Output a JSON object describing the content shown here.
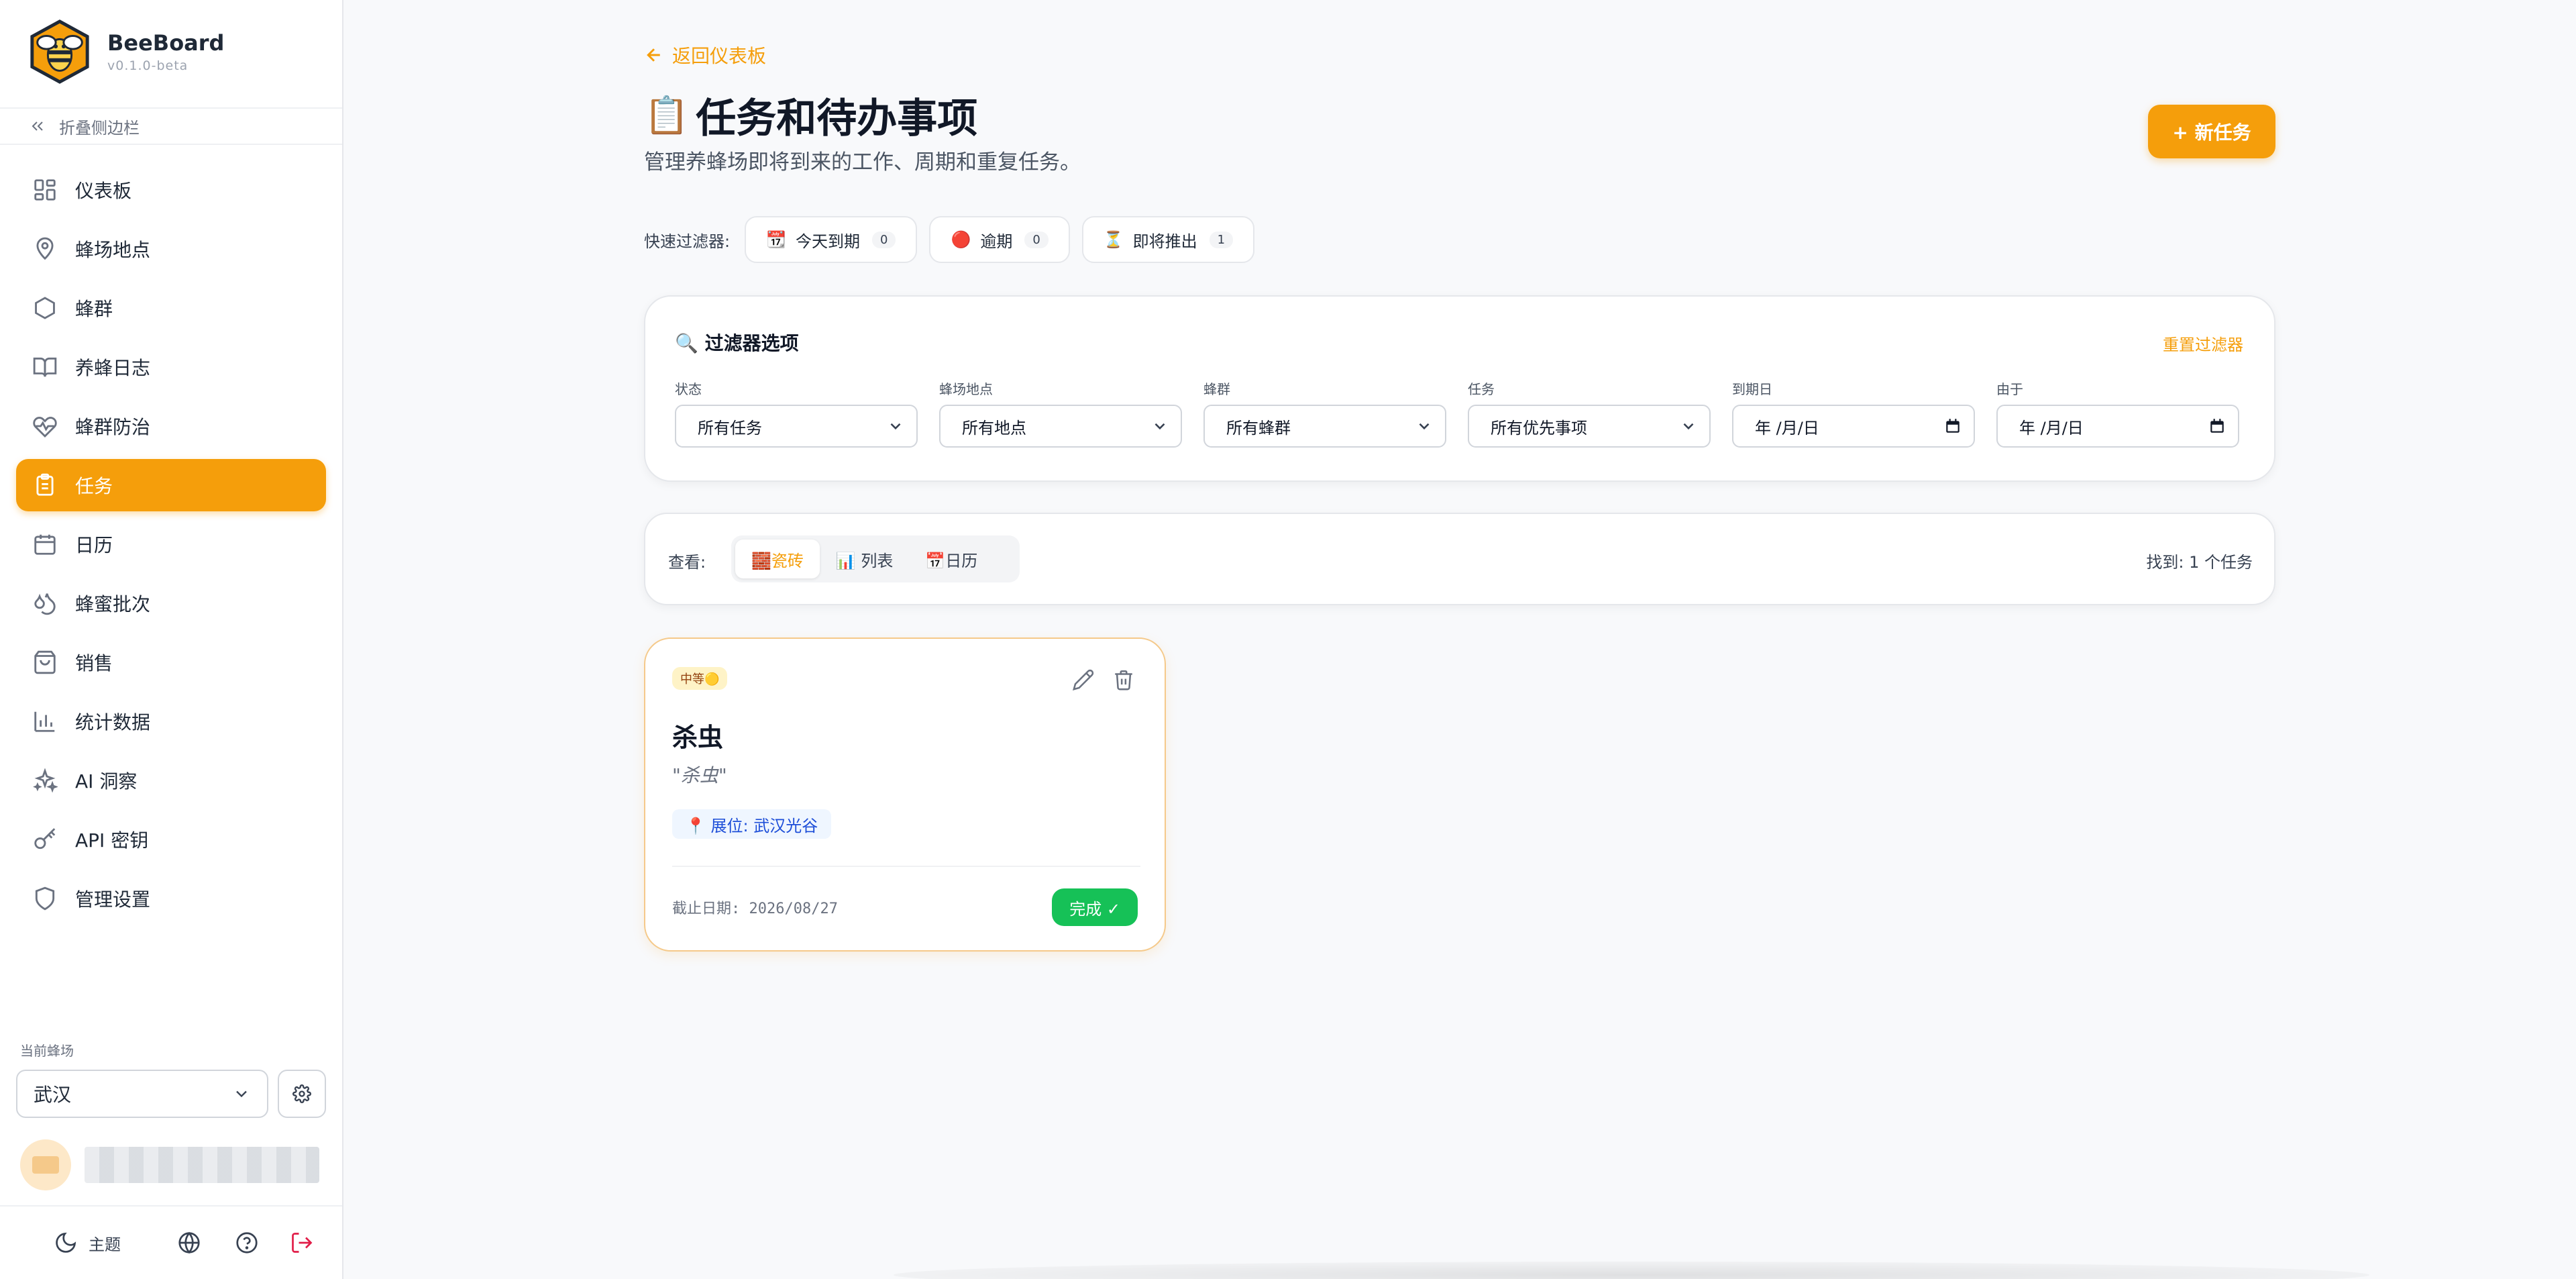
{
  "brand": {
    "name": "BeeBoard",
    "version": "v0.1.0-beta"
  },
  "sidebar": {
    "collapse_label": "折叠侧边栏",
    "items": [
      {
        "label": "仪表板",
        "icon": "dashboard-icon"
      },
      {
        "label": "蜂场地点",
        "icon": "map-pin-icon"
      },
      {
        "label": "蜂群",
        "icon": "hexagon-icon"
      },
      {
        "label": "养蜂日志",
        "icon": "book-icon"
      },
      {
        "label": "蜂群防治",
        "icon": "heart-pulse-icon"
      },
      {
        "label": "任务",
        "icon": "clipboard-icon",
        "active": true
      },
      {
        "label": "日历",
        "icon": "calendar-icon"
      },
      {
        "label": "蜂蜜批次",
        "icon": "droplets-icon"
      },
      {
        "label": "销售",
        "icon": "shopping-bag-icon"
      },
      {
        "label": "统计数据",
        "icon": "bar-chart-icon"
      },
      {
        "label": "AI 洞察",
        "icon": "sparkles-icon"
      },
      {
        "label": "API 密钥",
        "icon": "key-icon"
      },
      {
        "label": "管理设置",
        "icon": "shield-icon"
      }
    ],
    "current_apiary_label": "当前蜂场",
    "current_apiary": "武汉",
    "theme_label": "主题"
  },
  "header": {
    "back_label": "返回仪表板",
    "title_icon": "📋",
    "title": "任务和待办事项",
    "subtitle": "管理养蜂场即将到来的工作、周期和重复任务。",
    "new_task_label": "+ 新任务"
  },
  "quick_filters": {
    "label": "快速过滤器:",
    "chips": [
      {
        "icon": "📆",
        "label": "今天到期",
        "count": "0"
      },
      {
        "icon": "🔴",
        "label": "逾期",
        "count": "0"
      },
      {
        "icon": "⏳",
        "label": "即将推出",
        "count": "1"
      }
    ]
  },
  "filters": {
    "title": "🔍 过滤器选项",
    "reset_label": "重置过滤器",
    "fields": [
      {
        "label": "状态",
        "value": "所有任务",
        "type": "select"
      },
      {
        "label": "蜂场地点",
        "value": "所有地点",
        "type": "select"
      },
      {
        "label": "蜂群",
        "value": "所有蜂群",
        "type": "select"
      },
      {
        "label": "任务",
        "value": "所有优先事项",
        "type": "select"
      },
      {
        "label": "到期日",
        "value": "年 /月/日",
        "type": "date"
      },
      {
        "label": "由于",
        "value": "年 /月/日",
        "type": "date"
      }
    ]
  },
  "view": {
    "label": "查看:",
    "options": [
      {
        "label": "🧱瓷砖",
        "active": true
      },
      {
        "label": "📊 列表",
        "active": false
      },
      {
        "label": "📅日历",
        "active": false
      }
    ],
    "found_label": "找到: 1 个任务"
  },
  "tasks": [
    {
      "priority": "中等🟡",
      "title": "杀虫",
      "description": "\"杀虫\"",
      "location": "📍 展位: 武汉光谷",
      "due": "截止日期: 2026/08/27",
      "complete_label": "完成 ✓"
    }
  ],
  "colors": {
    "accent": "#f59e0b",
    "success": "#16c157",
    "location_bg": "#eff6ff"
  }
}
